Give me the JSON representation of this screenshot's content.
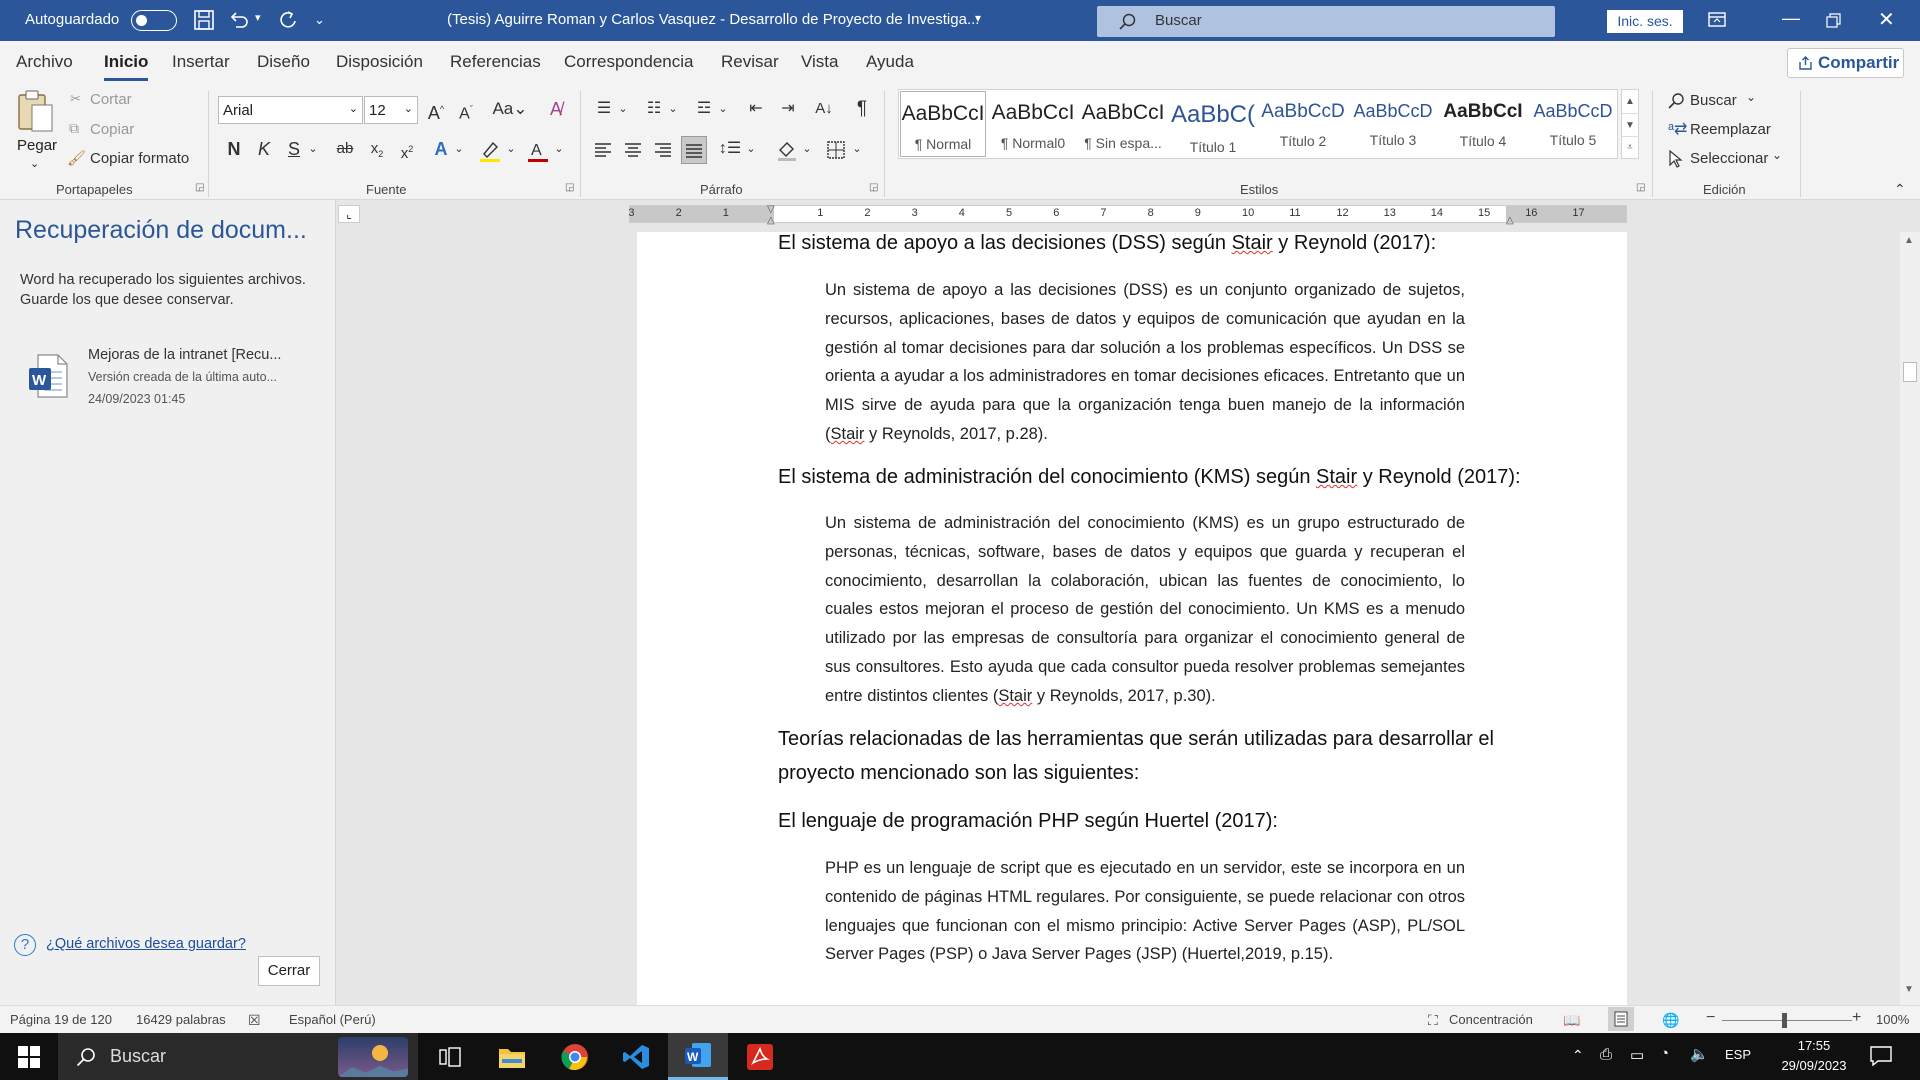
{
  "titlebar": {
    "autosave_label": "Autoguardado",
    "doc_title": "(Tesis) Aguirre Roman y Carlos Vasquez - Desarrollo de Proyecto de Investiga...",
    "search_placeholder": "Buscar",
    "signin_label": "Inic. ses.",
    "accent_color": "#2b579a"
  },
  "menu": {
    "tabs": [
      "Archivo",
      "Inicio",
      "Insertar",
      "Diseño",
      "Disposición",
      "Referencias",
      "Correspondencia",
      "Revisar",
      "Vista",
      "Ayuda"
    ],
    "active": "Inicio",
    "share_label": "Compartir"
  },
  "ribbon": {
    "clipboard": {
      "paste": "Pegar",
      "cut": "Cortar",
      "copy": "Copiar",
      "format_painter": "Copiar formato",
      "group": "Portapapeles"
    },
    "font": {
      "family": "Arial",
      "size": "12",
      "group": "Fuente"
    },
    "paragraph": {
      "group": "Párrafo"
    },
    "styles": {
      "group": "Estilos",
      "items": [
        {
          "preview": "AaBbCcI",
          "name": "¶ Normal"
        },
        {
          "preview": "AaBbCcI",
          "name": "¶ Normal0"
        },
        {
          "preview": "AaBbCcI",
          "name": "¶ Sin espa..."
        },
        {
          "preview": "AaBbC(",
          "name": "Título 1"
        },
        {
          "preview": "AaBbCcD",
          "name": "Título 2"
        },
        {
          "preview": "AaBbCcD",
          "name": "Título 3"
        },
        {
          "preview": "AaBbCcI",
          "name": "Título 4"
        },
        {
          "preview": "AaBbCcD",
          "name": "Título 5"
        }
      ]
    },
    "editing": {
      "find": "Buscar",
      "replace": "Reemplazar",
      "select": "Seleccionar",
      "group": "Edición"
    }
  },
  "recovery": {
    "title": "Recuperación de docum...",
    "description": "Word ha recuperado los siguientes archivos. Guarde los que desee conservar.",
    "file": {
      "name": "Mejoras de la intranet  [Recu...",
      "detail": "Versión creada de la última auto...",
      "date": "24/09/2023 01:45"
    },
    "help_link": "¿Qué archivos desea guardar?",
    "close_button": "Cerrar"
  },
  "ruler": {
    "ticks": [
      "3",
      "2",
      "1",
      "1",
      "2",
      "3",
      "4",
      "5",
      "6",
      "7",
      "8",
      "9",
      "10",
      "11",
      "12",
      "13",
      "14",
      "15",
      "16",
      "17"
    ]
  },
  "document": {
    "h1": {
      "pre": "El sistema de apoyo a las decisiones (DSS) según ",
      "sq": "Stair",
      "post": " y Reynold (2017):"
    },
    "p1": {
      "pre": "Un sistema de apoyo a las decisiones (DSS) es un conjunto organizado de sujetos, recursos, aplicaciones, bases de datos y equipos de comunicación que ayudan en la gestión al tomar decisiones para dar solución a los problemas específicos. Un DSS se orienta a ayudar a los administradores en tomar decisiones eficaces. Entretanto que un MIS sirve de ayuda para que la organización tenga buen manejo de la información (",
      "sq": "Stair",
      "post": " y Reynolds, 2017, p.28)."
    },
    "h2": {
      "pre": "El sistema de administración del conocimiento (KMS) según ",
      "sq": "Stair",
      "post": " y Reynold (2017):"
    },
    "p2": {
      "pre": "Un sistema de administración del conocimiento (KMS) es un grupo estructurado de personas, técnicas, software, bases de datos y equipos que guarda y recuperan el conocimiento, desarrollan la colaboración, ubican las fuentes de conocimiento, lo cuales estos mejoran el proceso de gestión del conocimiento. Un KMS es a menudo utilizado por las empresas de consultoría para organizar el conocimiento general de sus consultores. Esto ayuda que cada consultor pueda resolver problemas semejantes entre distintos clientes (",
      "sq": "Stair",
      "post": " y Reynolds, 2017, p.30)."
    },
    "h3_line1": "Teorías relacionadas de las herramientas que serán utilizadas para desarrollar el",
    "h3_line2": "proyecto mencionado son las siguientes:",
    "h4": "El lenguaje de programación PHP según Huertel (2017):",
    "p3": "PHP es un lenguaje de script que es ejecutado en un servidor, este se incorpora en un contenido de páginas HTML regulares. Por consiguiente, se puede relacionar con otros lenguajes que funcionan con el mismo principio: Active Server Pages (ASP), PL/SOL Server Pages (PSP) o Java Server Pages (JSP) (Huertel,2019, p.15)."
  },
  "statusbar": {
    "page": "Página 19 de 120",
    "words": "16429 palabras",
    "language": "Español (Perú)",
    "focus": "Concentración",
    "zoom": "100%"
  },
  "taskbar": {
    "search_placeholder": "Buscar",
    "lang": "ESP",
    "time": "17:55",
    "date": "29/09/2023"
  }
}
